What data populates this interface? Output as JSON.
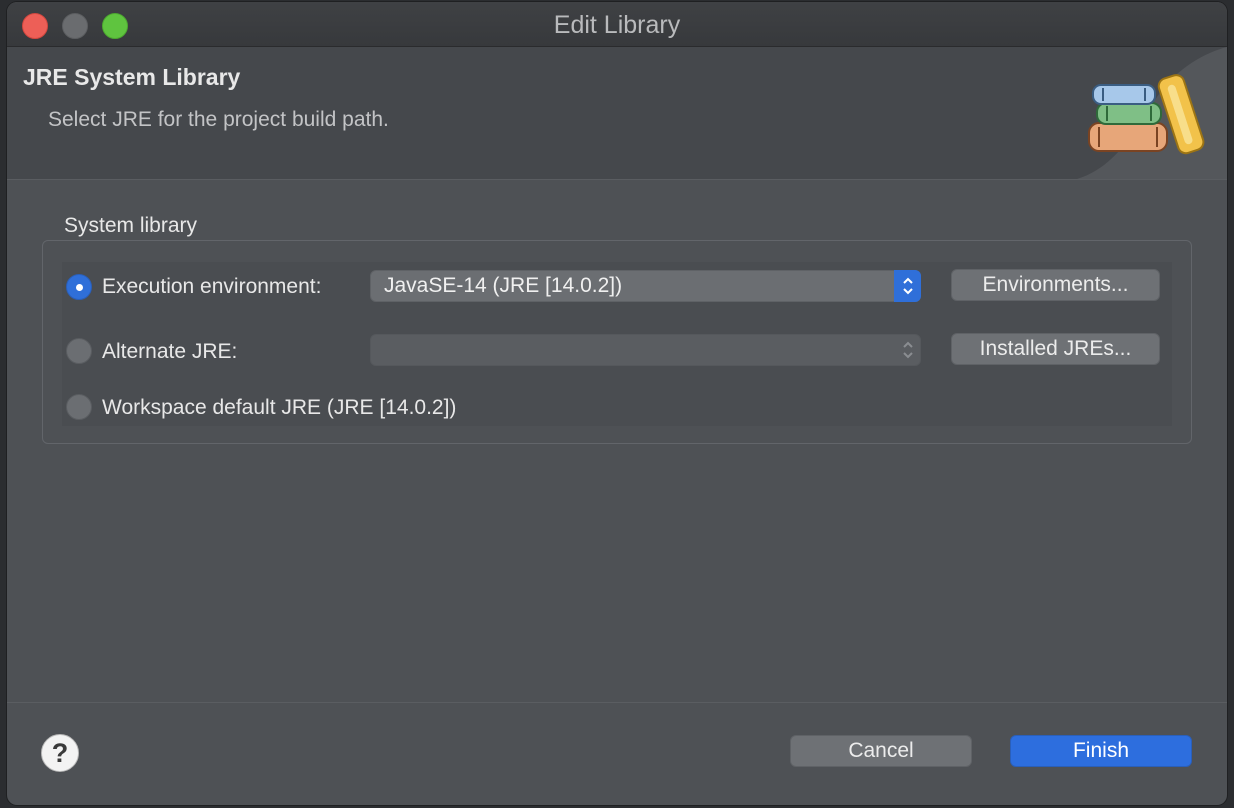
{
  "window": {
    "title": "Edit Library"
  },
  "header": {
    "title": "JRE System Library",
    "description": "Select JRE for the project build path."
  },
  "system_library": {
    "group_label": "System library",
    "execution_environment": {
      "label": "Execution environment:",
      "selected": true,
      "value": "JavaSE-14 (JRE [14.0.2])",
      "button_label": "Environments..."
    },
    "alternate_jre": {
      "label": "Alternate JRE:",
      "selected": false,
      "value": "",
      "button_label": "Installed JREs..."
    },
    "workspace_default": {
      "label": "Workspace default JRE (JRE [14.0.2])",
      "selected": false
    }
  },
  "footer": {
    "help_icon": "?",
    "cancel_label": "Cancel",
    "finish_label": "Finish"
  },
  "icons": {
    "header_image": "library-books-icon",
    "select_arrow": "up-down-chevron-icon",
    "help": "help-icon"
  },
  "colors": {
    "accent": "#2d6ede",
    "close": "#ed5f57",
    "maximize": "#5fc43f"
  }
}
